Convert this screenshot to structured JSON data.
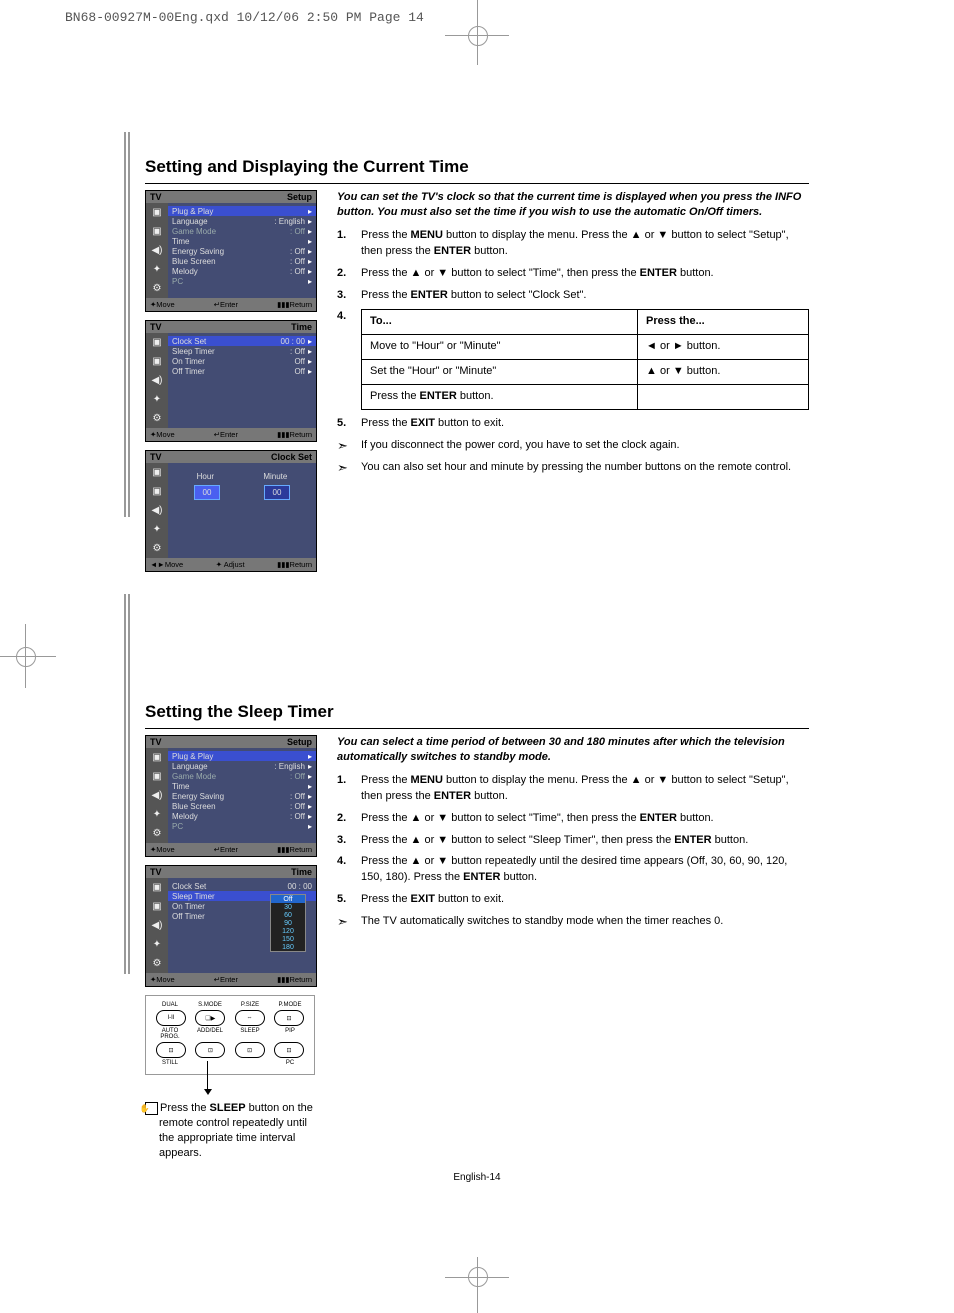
{
  "header": {
    "line": "BN68-00927M-00Eng.qxd  10/12/06 2:50 PM  Page 14"
  },
  "footer": {
    "page": "English-14"
  },
  "section1": {
    "title": "Setting and Displaying the Current Time",
    "intro": "You can set the TV's clock so that the current time is displayed when you press the INFO button. You must also set the time if you wish to use the automatic On/Off timers.",
    "steps": {
      "s1a": "Press the ",
      "s1b": "MENU",
      "s1c": " button to display the menu. Press the  ▲  or  ▼  button to select \"Setup\", then press the ",
      "s1d": "ENTER",
      "s1e": " button.",
      "s2a": "Press the  ▲  or  ▼  button to select \"Time\", then press the ",
      "s2b": "ENTER",
      "s2c": " button.",
      "s3a": "Press the ",
      "s3b": "ENTER",
      "s3c": " button to select \"Clock Set\".",
      "s5a": "Press the ",
      "s5b": "EXIT",
      "s5c": " button to exit."
    },
    "table": {
      "h1": "To...",
      "h2": "Press the...",
      "r1c1": "Move to \"Hour\" or \"Minute\"",
      "r1c2": "◄  or  ►  button.",
      "r2c1": "Set the \"Hour\" or \"Minute\"",
      "r2c2": "▲  or  ▼  button.",
      "r3c1a": "Press the ",
      "r3c1b": "ENTER",
      "r3c1c": " button."
    },
    "notes": {
      "n1": "If you disconnect the power cord, you have to set the clock again.",
      "n2": "You can also set hour and minute by pressing the number buttons on the remote control."
    },
    "panel_setup": {
      "name": "TV",
      "heading": "Setup",
      "rows": [
        [
          "Plug & Play",
          ""
        ],
        [
          "Language",
          ": English"
        ],
        [
          "Game Mode",
          ": Off"
        ],
        [
          "Time",
          ""
        ],
        [
          "Energy Saving",
          ": Off"
        ],
        [
          "Blue Screen",
          ": Off"
        ],
        [
          "Melody",
          ": Off"
        ],
        [
          "PC",
          ""
        ]
      ],
      "foot": [
        "✦Move",
        "↵Enter",
        "▮▮▮Return"
      ]
    },
    "panel_time": {
      "name": "TV",
      "heading": "Time",
      "rows": [
        [
          "Clock Set",
          "00 : 00"
        ],
        [
          "Sleep Timer",
          ": Off"
        ],
        [
          "On Timer",
          "Off"
        ],
        [
          "Off Timer",
          "Off"
        ]
      ],
      "foot": [
        "✦Move",
        "↵Enter",
        "▮▮▮Return"
      ]
    },
    "panel_clock": {
      "name": "TV",
      "heading": "Clock Set",
      "labels": {
        "hour": "Hour",
        "minute": "Minute",
        "h": "00",
        "m": "00"
      },
      "foot": [
        "◄►Move",
        "✦ Adjust",
        "▮▮▮Return"
      ]
    }
  },
  "section2": {
    "title": "Setting the Sleep Timer",
    "intro": "You can select a time period of between 30 and 180 minutes after which the television automatically switches to standby mode.",
    "steps": {
      "s1a": "Press the ",
      "s1b": "MENU",
      "s1c": " button to display the menu. Press the  ▲  or  ▼  button to select \"Setup\", then press the ",
      "s1d": "ENTER",
      "s1e": " button.",
      "s2a": "Press the  ▲  or  ▼  button to select \"Time\", then press the ",
      "s2b": "ENTER",
      "s2c": " button.",
      "s3a": "Press the  ▲  or  ▼  button to select \"Sleep Timer\", then press the ",
      "s3b": "ENTER",
      "s3c": " button.",
      "s4a": "Press the  ▲  or  ▼  button repeatedly until the desired time appears (Off, 30, 60, 90, 120, 150, 180). Press the ",
      "s4b": "ENTER",
      "s4c": " button.",
      "s5a": "Press the ",
      "s5b": "EXIT",
      "s5c": " button to exit."
    },
    "notes": {
      "n1": "The TV automatically switches to standby mode when the timer reaches 0."
    },
    "panel_time": {
      "name": "TV",
      "heading": "Time",
      "rows": [
        [
          "Clock Set",
          "00 : 00"
        ],
        [
          "Sleep Timer",
          "Off"
        ],
        [
          "On Timer",
          "Off"
        ],
        [
          "Off Timer",
          "Off"
        ]
      ],
      "dd": [
        "Off",
        "30",
        "60",
        "90",
        "120",
        "150",
        "180"
      ],
      "foot": [
        "✦Move",
        "↵Enter",
        "▮▮▮Return"
      ]
    },
    "remote": {
      "labels_top": [
        "DUAL",
        "S.MODE",
        "P.SIZE",
        "P.MODE"
      ],
      "buttons_top": [
        "I-II",
        "❑▶",
        "⇔",
        "⊡"
      ],
      "labels_bot": [
        "AUTO PROG.",
        "ADD/DEL",
        "SLEEP",
        "PIP"
      ],
      "buttons_bot": [
        "⊡",
        "⊡",
        "⊡",
        "⊡"
      ],
      "last": "STILL",
      "lastr": "PC"
    },
    "caption_a": "Press the ",
    "caption_b": "SLEEP",
    "caption_c": " button on the remote control repeatedly until the appropriate time interval appears."
  }
}
